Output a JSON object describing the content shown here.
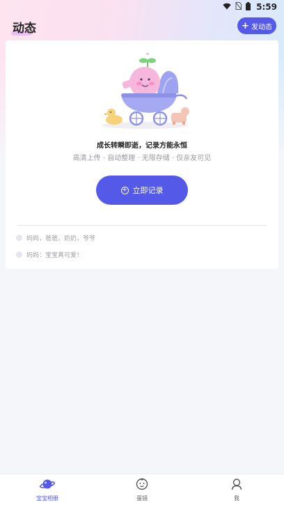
{
  "status_bar": {
    "time": "5:59"
  },
  "header": {
    "title": "动态",
    "post_button_label": "发动态"
  },
  "card": {
    "slogan": "成长转瞬即逝，记录方能永恒",
    "sub_slogan": "高清上传 · 自动整理 · 无限存储 · 仅亲友可见",
    "record_button_label": "立即记录",
    "rows": [
      {
        "text": "妈妈，爸爸，奶奶，爷爷"
      },
      {
        "text": "妈妈：宝宝真可爱！"
      }
    ]
  },
  "tabs": [
    {
      "label": "宝宝相册",
      "icon": "planet-icon",
      "active": true
    },
    {
      "label": "蛋镜",
      "icon": "baby-face-icon",
      "active": false
    },
    {
      "label": "我",
      "icon": "profile-icon",
      "active": false
    }
  ],
  "colors": {
    "accent": "#5459e8",
    "illustration_pink": "#f7b6dc",
    "illustration_purple": "#a5a9f2"
  }
}
